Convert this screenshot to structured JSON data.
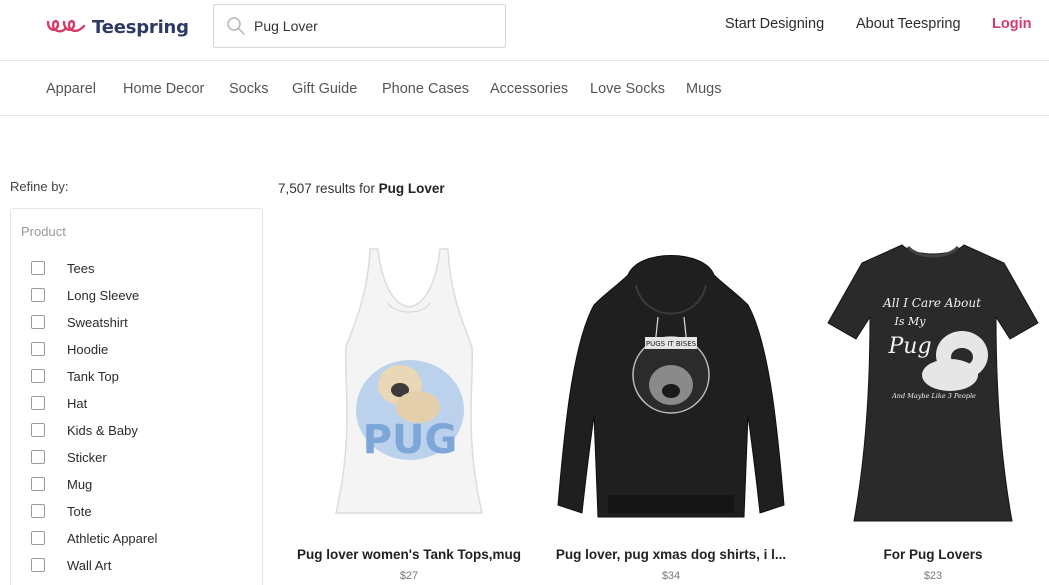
{
  "header": {
    "brand": "Teespring",
    "search": {
      "value": "Pug Lover",
      "placeholder": ""
    },
    "nav": {
      "start_designing": "Start Designing",
      "about": "About Teespring",
      "login": "Login"
    }
  },
  "categories": [
    "Apparel",
    "Home Decor",
    "Socks",
    "Gift Guide",
    "Phone Cases",
    "Accessories",
    "Love Socks",
    "Mugs"
  ],
  "sidebar": {
    "refine_label": "Refine by:",
    "filter_title": "Product",
    "items": [
      "Tees",
      "Long Sleeve",
      "Sweatshirt",
      "Hoodie",
      "Tank Top",
      "Hat",
      "Kids & Baby",
      "Sticker",
      "Mug",
      "Tote",
      "Athletic Apparel",
      "Wall Art"
    ]
  },
  "results": {
    "count": "7,507",
    "prefix": "results for",
    "query": "Pug Lover"
  },
  "products": [
    {
      "title": "Pug lover women's Tank Tops,mug",
      "price": "$27",
      "art_text": "PUG"
    },
    {
      "title": "Pug lover, pug xmas dog shirts, i l...",
      "price": "$34",
      "art_text": "PUGS IT BISES"
    },
    {
      "title": "For Pug Lovers",
      "price": "$23",
      "art_lines": [
        "All I Care About",
        "Is My",
        "Pug",
        "And Maybe Like 3 People"
      ]
    }
  ],
  "colors": {
    "brand": "#2c3a66",
    "accent": "#d63a6a"
  }
}
